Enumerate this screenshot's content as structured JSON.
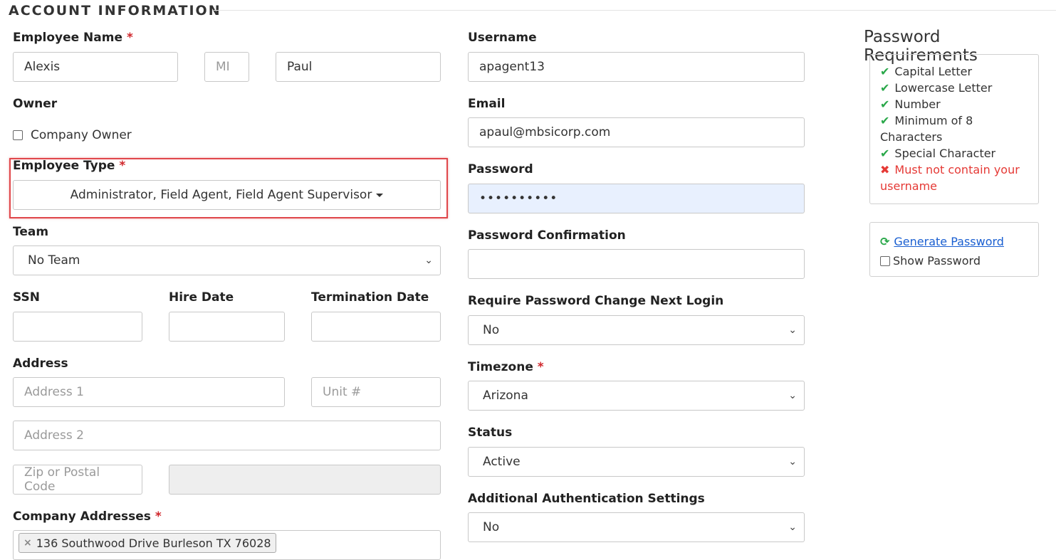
{
  "section": {
    "title": "ACCOUNT INFORMATION"
  },
  "employee_name": {
    "label": "Employee Name",
    "first": "Alexis",
    "mi_placeholder": "MI",
    "last": "Paul"
  },
  "owner": {
    "label": "Owner",
    "checkbox_label": "Company Owner",
    "checked": false
  },
  "employee_type": {
    "label": "Employee Type",
    "value": "Administrator, Field Agent, Field Agent Supervisor"
  },
  "team": {
    "label": "Team",
    "value": "No Team"
  },
  "ssn": {
    "label": "SSN",
    "value": ""
  },
  "hire_date": {
    "label": "Hire Date",
    "value": ""
  },
  "termination_date": {
    "label": "Termination Date",
    "value": ""
  },
  "address": {
    "label": "Address",
    "address1_placeholder": "Address 1",
    "unit_placeholder": "Unit #",
    "address2_placeholder": "Address 2",
    "zip_placeholder": "Zip or Postal Code",
    "city_value": ""
  },
  "company_addresses": {
    "label": "Company Addresses",
    "selected": [
      "136 Southwood Drive Burleson TX 76028"
    ]
  },
  "username": {
    "label": "Username",
    "value": "apagent13"
  },
  "email": {
    "label": "Email",
    "value": "apaul@mbsicorp.com"
  },
  "password": {
    "label": "Password",
    "value": "••••••••••"
  },
  "password_confirmation": {
    "label": "Password Confirmation",
    "value": ""
  },
  "require_password_change": {
    "label": "Require Password Change Next Login",
    "value": "No"
  },
  "timezone": {
    "label": "Timezone",
    "value": "Arizona"
  },
  "status": {
    "label": "Status",
    "value": "Active"
  },
  "additional_auth": {
    "label": "Additional Authentication Settings",
    "value": "No"
  },
  "password_requirements": {
    "title": "Password Requirements",
    "items": [
      {
        "text": "Capital Letter",
        "met": true
      },
      {
        "text": "Lowercase Letter",
        "met": true
      },
      {
        "text": "Number",
        "met": true
      },
      {
        "text": "Minimum of 8 Characters",
        "met": true
      },
      {
        "text": "Special Character",
        "met": true
      },
      {
        "text": "Must not contain your username",
        "met": false
      }
    ]
  },
  "password_tools": {
    "generate_label": "Generate Password",
    "show_password_label": "Show Password",
    "show_password_checked": false
  },
  "colors": {
    "required": "#d0262b",
    "met": "#2aa84a",
    "unmet": "#e53935",
    "link": "#1a5fd1",
    "highlight": "#e0474b",
    "autofill": "#e8f0fe"
  },
  "icons": {
    "met": "check-icon",
    "unmet": "x-icon",
    "generate": "refresh-icon",
    "select": "chevron-down-icon",
    "dropdown": "caret-down-icon"
  }
}
